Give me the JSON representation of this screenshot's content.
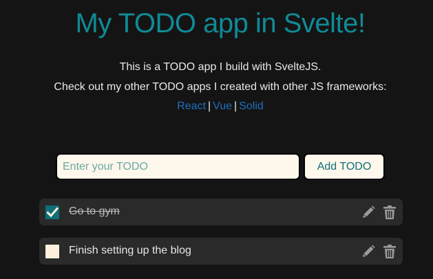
{
  "header": {
    "title": "My TODO app in Svelte!",
    "description_line1": "This is a TODO app I build with SvelteJS.",
    "description_line2": "Check out my other TODO apps I created with other JS frameworks:"
  },
  "links": [
    {
      "label": "React"
    },
    {
      "label": "Vue"
    },
    {
      "label": "Solid"
    }
  ],
  "link_separator": "|",
  "form": {
    "input_value": "",
    "input_placeholder": "Enter your TODO",
    "add_button_label": "Add TODO"
  },
  "todos": [
    {
      "text": "Go to gym",
      "completed": true
    },
    {
      "text": "Finish setting up the blog",
      "completed": false
    }
  ],
  "icons": {
    "edit": "pencil-icon",
    "delete": "trash-icon",
    "check": "checkmark-icon"
  },
  "colors": {
    "background": "#141414",
    "title": "#108a96",
    "link": "#1f6fbf",
    "accent": "#0f6f78",
    "input_bg": "#fdf7ec",
    "item_bg": "#2a2a2a"
  }
}
